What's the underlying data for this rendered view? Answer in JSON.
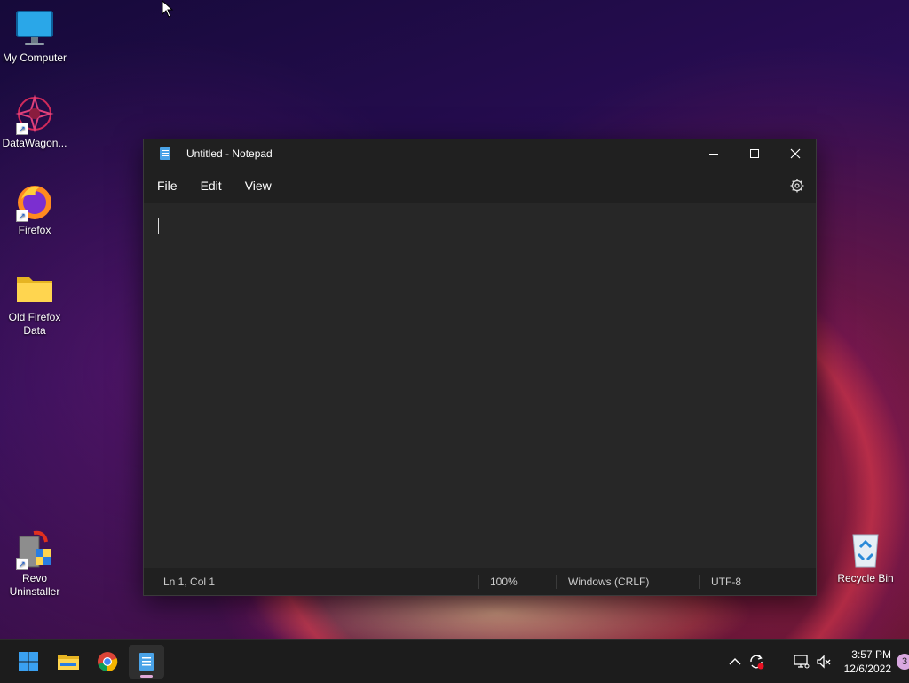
{
  "desktop": {
    "icons": [
      {
        "label": "My Computer"
      },
      {
        "label": "DataWagon..."
      },
      {
        "label": "Firefox"
      },
      {
        "label": "Old Firefox Data"
      },
      {
        "label": "Revo Uninstaller"
      },
      {
        "label": "Recycle Bin"
      }
    ]
  },
  "notepad": {
    "title": "Untitled - Notepad",
    "menu": [
      "File",
      "Edit",
      "View"
    ],
    "content": "",
    "status": {
      "position": "Ln 1, Col 1",
      "zoom": "100%",
      "line_ending": "Windows (CRLF)",
      "encoding": "UTF-8"
    }
  },
  "taskbar": {
    "apps": [
      "start-icon",
      "file-explorer-icon",
      "chrome-icon",
      "notepad-icon"
    ],
    "clock": {
      "time": "3:57 PM",
      "date": "12/6/2022"
    },
    "notifications": "3"
  },
  "colors": {
    "accent": "#e0a9d8",
    "window_bg": "#272727",
    "titlebar_bg": "#202020"
  }
}
